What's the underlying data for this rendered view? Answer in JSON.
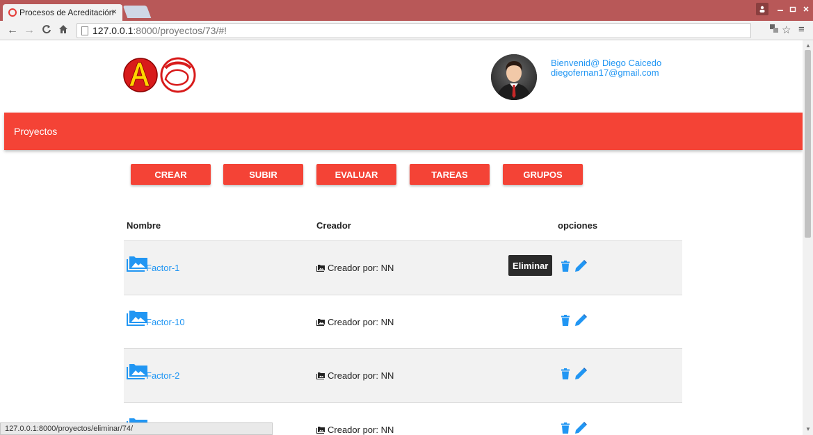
{
  "browser": {
    "tab_title": "Procesos de Acreditación",
    "tab_close": "×",
    "url_host": "127.0.0.1",
    "url_path": ":8000/proyectos/73/#!",
    "status_url": "127.0.0.1:8000/proyectos/eliminar/74/"
  },
  "header": {
    "welcome_line": "Bienvenid@ Diego Caicedo",
    "email": "diegofernan17@gmail.com"
  },
  "navbar": {
    "brand": "Proyectos"
  },
  "actions": [
    {
      "label": "CREAR"
    },
    {
      "label": "SUBIR"
    },
    {
      "label": "EVALUAR"
    },
    {
      "label": "TAREAS"
    },
    {
      "label": "GRUPOS"
    }
  ],
  "table": {
    "columns": [
      "Nombre",
      "Creador",
      "opciones"
    ],
    "rows": [
      {
        "name": "Factor-1",
        "creator": "Creador por: NN"
      },
      {
        "name": "Factor-10",
        "creator": "Creador por: NN"
      },
      {
        "name": "Factor-2",
        "creator": "Creador por: NN"
      },
      {
        "name": "",
        "creator": "Creador por: NN"
      }
    ],
    "tooltip": "Eliminar"
  },
  "colors": {
    "primary": "#f44336",
    "link": "#2196f3",
    "titlebar": "#b85858"
  },
  "icons": {
    "row_icon": "folder-image-icon",
    "creator_icon": "folder-image-icon",
    "delete_icon": "trash-icon",
    "edit_icon": "pencil-icon"
  }
}
